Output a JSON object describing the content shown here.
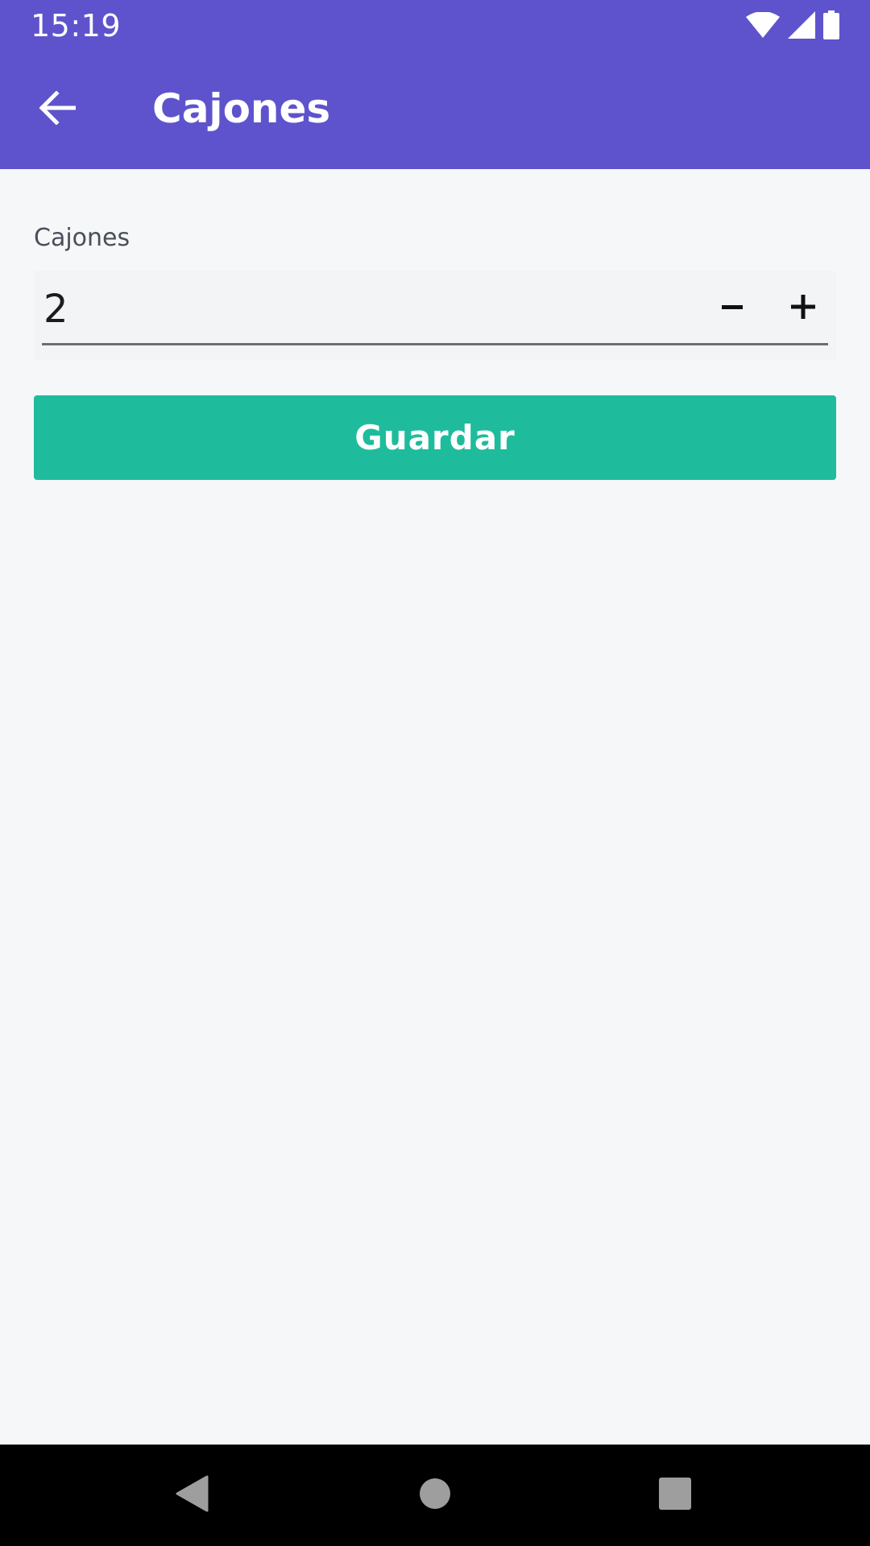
{
  "status_bar": {
    "time": "15:19",
    "icons": [
      "wifi-icon",
      "signal-icon",
      "battery-icon"
    ]
  },
  "app_bar": {
    "title": "Cajones",
    "back_icon": "arrow-back-icon",
    "background_color": "#5e53cd"
  },
  "form": {
    "field_label": "Cajones",
    "value": "2",
    "decrement_icon": "minus-icon",
    "increment_icon": "plus-icon",
    "save_label": "Guardar",
    "save_color": "#1ebc9c"
  },
  "nav_bar": {
    "icons": [
      "nav-back-icon",
      "nav-home-icon",
      "nav-recents-icon"
    ]
  }
}
